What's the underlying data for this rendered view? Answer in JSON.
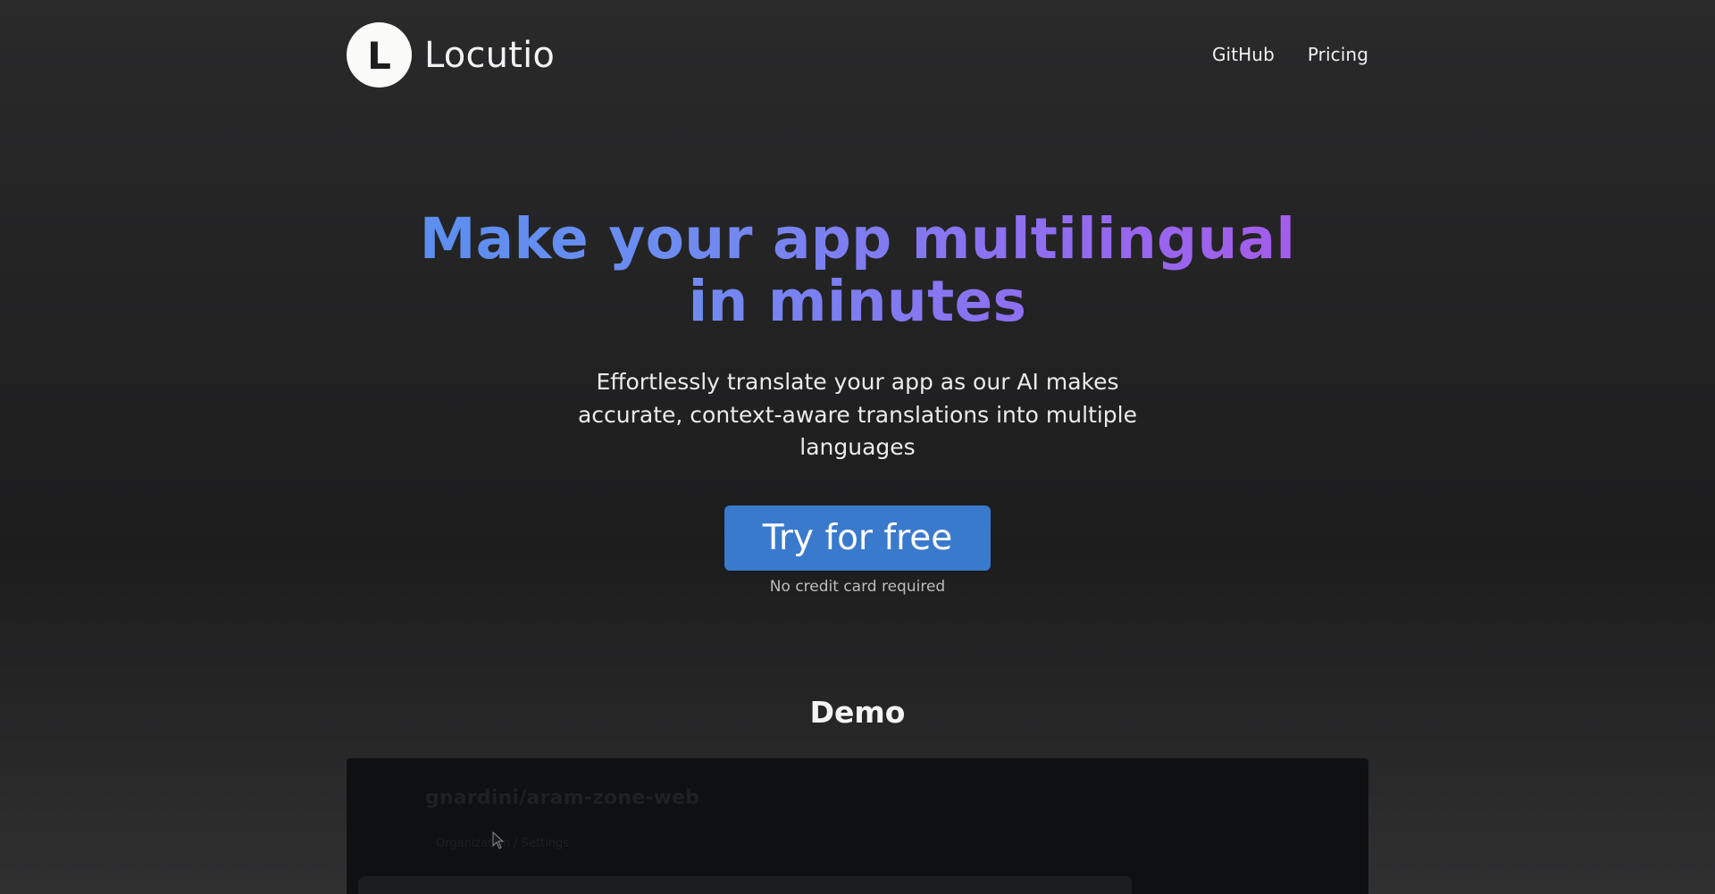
{
  "header": {
    "logo_letter": "L",
    "brand_name": "Locutio",
    "nav": [
      {
        "label": "GitHub"
      },
      {
        "label": "Pricing"
      }
    ]
  },
  "hero": {
    "title_line1": "Make your app multilingual",
    "title_line2": "in minutes",
    "subtitle_line1": "Effortlessly translate your app as our AI makes",
    "subtitle_line2": "accurate, context-aware translations into multiple",
    "subtitle_line3": "languages",
    "cta_label": "Try for free",
    "cta_note": "No credit card required"
  },
  "demo": {
    "heading": "Demo",
    "repo_title": "gnardini/aram-zone-web",
    "breadcrumb": "Organization / Settings"
  },
  "colors": {
    "cta": "#3a7acd",
    "gradient_start": "#5b8fef",
    "gradient_end": "#a65bea",
    "background": "#252526"
  },
  "icons": [
    "mouse-cursor-icon"
  ]
}
